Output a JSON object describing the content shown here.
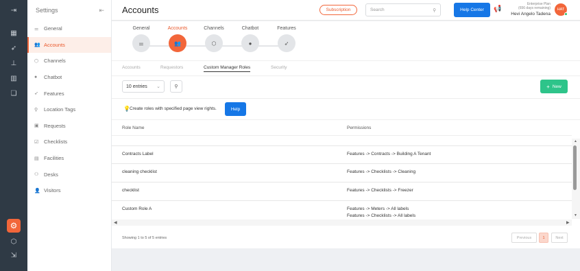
{
  "rail": {
    "icons": [
      "menu-expand-icon",
      "dashboard-icon",
      "rocket-icon",
      "tree-icon",
      "analytics-icon",
      "documents-icon",
      "gear-icon",
      "box-icon",
      "logout-icon"
    ]
  },
  "nav": {
    "title": "Settings",
    "items": [
      {
        "label": "General",
        "icon": "sliders-icon",
        "active": false
      },
      {
        "label": "Accounts",
        "icon": "users-icon",
        "active": true
      },
      {
        "label": "Channels",
        "icon": "cube-icon",
        "active": false
      },
      {
        "label": "Chatbot",
        "icon": "chat-icon",
        "active": false
      },
      {
        "label": "Features",
        "icon": "rocket-icon",
        "active": false
      },
      {
        "label": "Location Tags",
        "icon": "location-icon",
        "active": false
      },
      {
        "label": "Requests",
        "icon": "request-icon",
        "active": false
      },
      {
        "label": "Checklists",
        "icon": "checklist-icon",
        "active": false
      },
      {
        "label": "Facilities",
        "icon": "facility-icon",
        "active": false
      },
      {
        "label": "Desks",
        "icon": "desk-icon",
        "active": false
      },
      {
        "label": "Visitors",
        "icon": "visitor-icon",
        "active": false
      }
    ]
  },
  "header": {
    "title": "Accounts",
    "subscription": "Subscription",
    "search_placeholder": "Search",
    "help_center": "Help Center",
    "plan_line1": "Enterprise Plan",
    "plan_line2": "(656 days remaining)",
    "user_name": "Hevi Angelo Tadena",
    "avatar_initials": "HAT"
  },
  "steps": [
    {
      "label": "General",
      "icon": "sliders-icon",
      "active": false
    },
    {
      "label": "Accounts",
      "icon": "users-icon",
      "active": true
    },
    {
      "label": "Channels",
      "icon": "cube-icon",
      "active": false
    },
    {
      "label": "Chatbot",
      "icon": "chat-icon",
      "active": false
    },
    {
      "label": "Features",
      "icon": "rocket-icon",
      "active": false
    }
  ],
  "tabs": [
    "Accounts",
    "Requestors",
    "Custom Manager Roles",
    "Security"
  ],
  "active_tab": "Custom Manager Roles",
  "toolbar": {
    "entries": "10 entries",
    "new_label": "New"
  },
  "info": {
    "text": "Create roles with specified page view rights.",
    "help": "Help"
  },
  "table": {
    "headers": [
      "Role Name",
      "Permissions"
    ],
    "rows": [
      {
        "name": "Contracts Label",
        "permissions": [
          "Features -> Contracts -> Building A Tenant"
        ]
      },
      {
        "name": "cleaning checklist",
        "permissions": [
          "Features -> Checklists -> Cleaning"
        ]
      },
      {
        "name": "checklist",
        "permissions": [
          "Features -> Checklists -> Freezer"
        ]
      },
      {
        "name": "Custom Role A",
        "permissions": [
          "Features -> Meters -> All labels",
          "Features -> Checklists -> All labels"
        ]
      }
    ]
  },
  "footer": {
    "showing": "Showing 1 to 5 of 5 entries",
    "previous": "Previous",
    "page": "1",
    "next": "Next"
  },
  "colors": {
    "accent": "#f2663a",
    "primary": "#1677e6",
    "success": "#2ec48a",
    "rail": "#2f3a45"
  }
}
